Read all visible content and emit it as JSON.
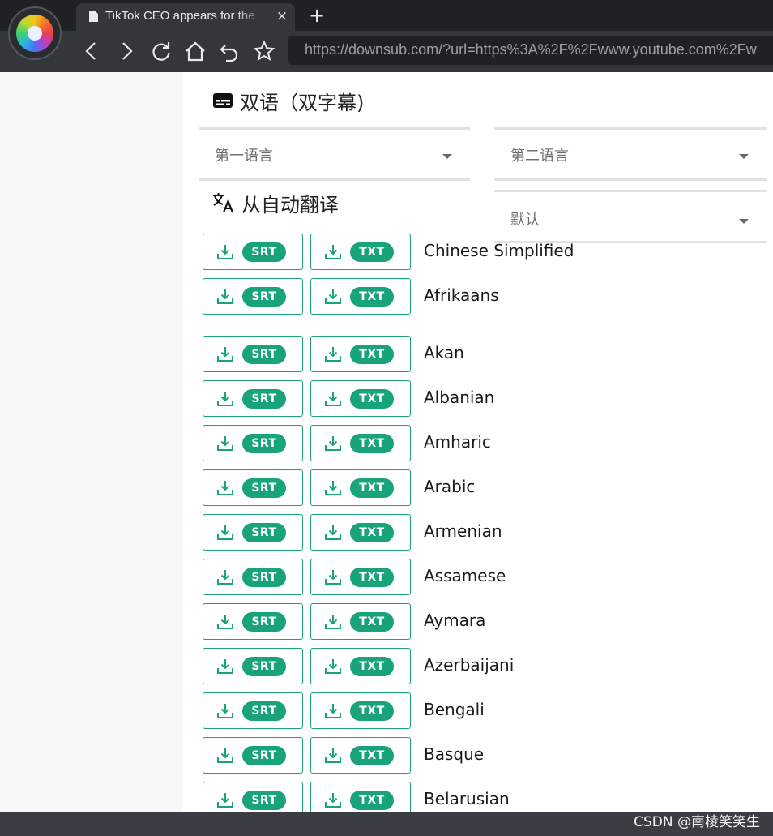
{
  "browser": {
    "tab_title": "TikTok CEO appears for the",
    "tab_close": "×",
    "new_tab": "+",
    "url": "https://downsub.com/?url=https%3A%2F%2Fwww.youtube.com%2Fw"
  },
  "bilingual": {
    "title": "双语（双字幕)",
    "icon": "subtitles-icon",
    "first_language_placeholder": "第一语言",
    "second_language_placeholder": "第二语言",
    "default_option": "默认"
  },
  "auto_translate": {
    "title": "从自动翻译",
    "icon": "translate-icon"
  },
  "download": {
    "srt_label": "SRT",
    "txt_label": "TXT",
    "icon": "download-icon",
    "accent_color": "#19a37a"
  },
  "languages": [
    "Chinese Simplified",
    "Afrikaans",
    "Akan",
    "Albanian",
    "Amharic",
    "Arabic",
    "Armenian",
    "Assamese",
    "Aymara",
    "Azerbaijani",
    "Bengali",
    "Basque",
    "Belarusian"
  ],
  "watermark": "CSDN @南棱笑笑生"
}
